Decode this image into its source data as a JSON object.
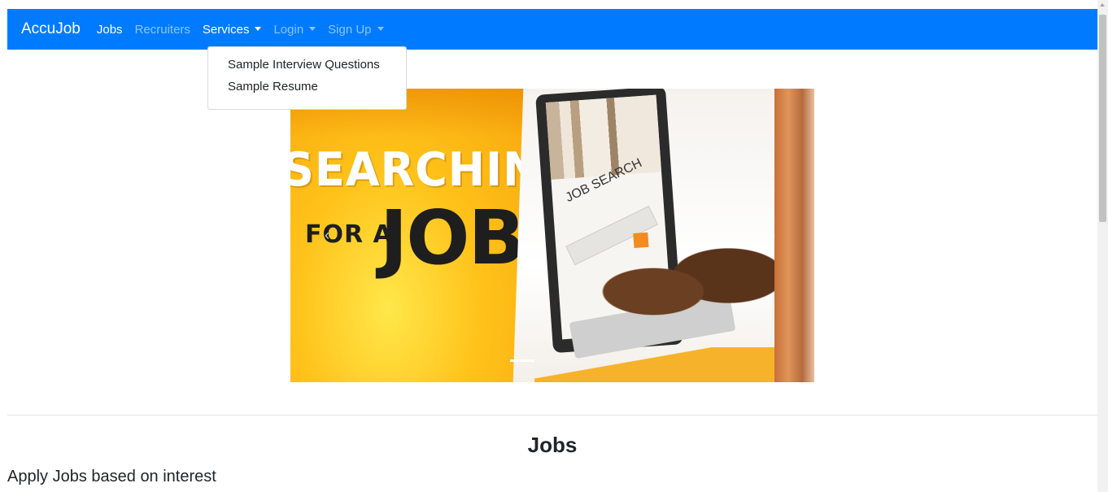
{
  "navbar": {
    "brand": "AccuJob",
    "links": [
      {
        "label": "Jobs",
        "active": true
      },
      {
        "label": "Recruiters",
        "active": false
      },
      {
        "label": "Services",
        "active": true,
        "dropdown": true
      },
      {
        "label": "Login",
        "active": false,
        "dropdown": true
      },
      {
        "label": "Sign Up",
        "active": false,
        "dropdown": true
      }
    ],
    "color": "#007bff"
  },
  "services_dropdown": {
    "items": [
      "Sample Interview Questions",
      "Sample Resume"
    ]
  },
  "carousel": {
    "slide_text": {
      "line1": "SEARCHING",
      "line2": "FOR A",
      "line3": "JOB?",
      "screen_text": "JOB SEARCH"
    },
    "prev_icon": "chevron-left-icon",
    "next_icon": "chevron-right-icon"
  },
  "main": {
    "heading": "Jobs",
    "subtext": "Apply Jobs based on interest"
  }
}
